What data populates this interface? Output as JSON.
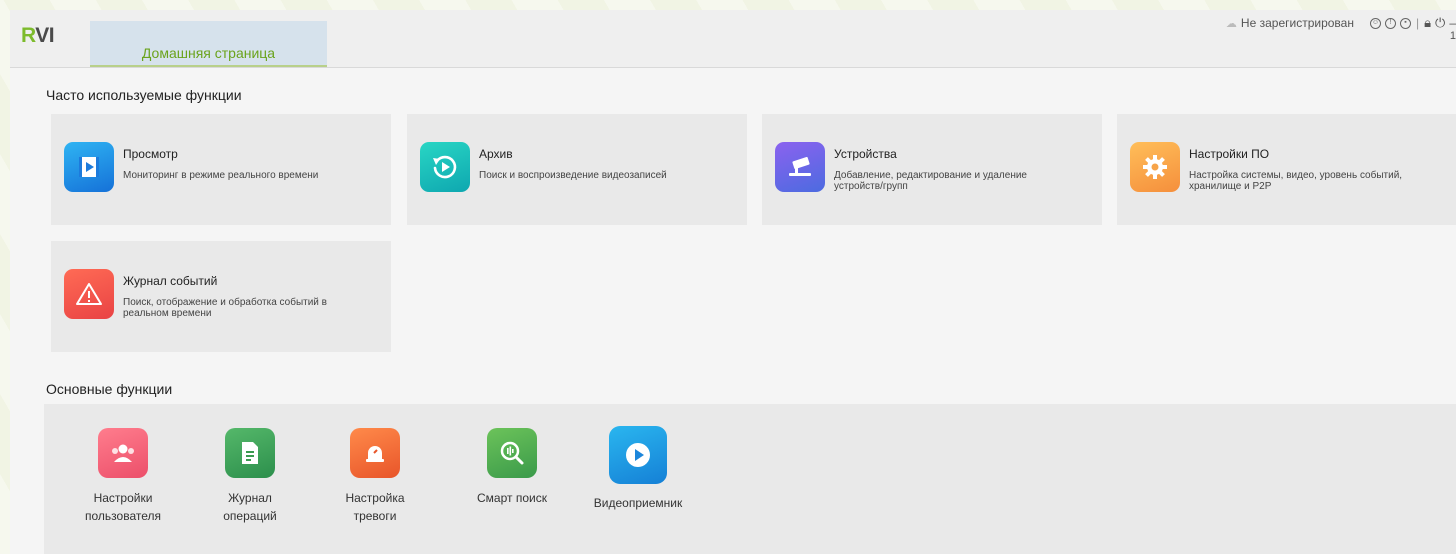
{
  "header": {
    "logo_r": "R",
    "logo_rest": "VI",
    "home_tab": "Домашняя страница",
    "user_status": "Не зарегистрирован",
    "clock_partial": "1"
  },
  "frequent": {
    "title": "Часто используемые функции",
    "tiles": [
      {
        "title": "Просмотр",
        "desc": "Мониторинг в режиме реального времени",
        "icon": "live-view-icon",
        "color": "#1e8ee6"
      },
      {
        "title": "Архив",
        "desc": "Поиск и воспроизведение видеозаписей",
        "icon": "playback-icon",
        "color": "#19bdbb"
      },
      {
        "title": "Устройства",
        "desc": "Добавление, редактирование и удаление устройств/групп",
        "icon": "camera-device-icon",
        "color": "#6b66e8"
      },
      {
        "title": "Настройки ПО",
        "desc": "Настройка системы, видео, уровень событий, хранилище и P2P",
        "icon": "gear-icon",
        "color": "#f7a449"
      },
      {
        "title": "Журнал событий",
        "desc": "Поиск, отображение и обработка событий в реальном времени",
        "icon": "warning-icon",
        "color": "#f05a4b"
      }
    ]
  },
  "basic": {
    "title": "Основные функции",
    "items": [
      {
        "line1": "Настройки",
        "line2": "пользователя",
        "icon": "users-icon"
      },
      {
        "line1": "Журнал",
        "line2": "операций",
        "icon": "document-icon"
      },
      {
        "line1": "Настройка",
        "line2": "тревоги",
        "icon": "alarm-icon"
      },
      {
        "line1": "Смарт поиск",
        "line2": "",
        "icon": "smart-search-icon"
      },
      {
        "line1": "Видеоприемник",
        "line2": "",
        "icon": "video-receiver-icon"
      }
    ]
  }
}
